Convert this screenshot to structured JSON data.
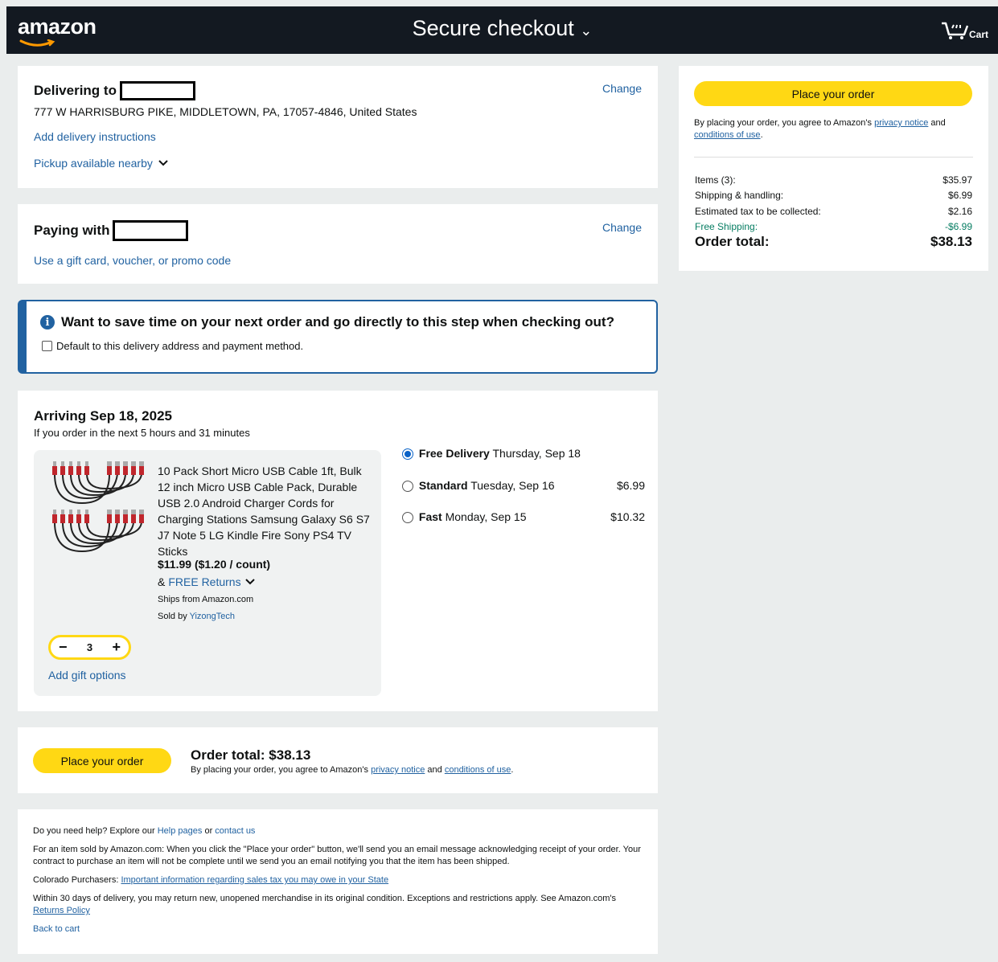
{
  "header": {
    "logo": "amazon",
    "title": "Secure checkout",
    "cart_label": "Cart"
  },
  "delivery": {
    "heading": "Delivering to",
    "address": "777 W HARRISBURG PIKE, MIDDLETOWN, PA, 17057-4846, United States",
    "change": "Change",
    "instructions_link": "Add delivery instructions",
    "pickup_link": "Pickup available nearby"
  },
  "payment": {
    "heading": "Paying with",
    "change": "Change",
    "gift_link": "Use a gift card, voucher, or promo code"
  },
  "banner": {
    "question": "Want to save time on your next order and go directly to this step when checking out?",
    "checkbox_label": "Default to this delivery address and payment method."
  },
  "shipment": {
    "arriving": "Arriving Sep 18, 2025",
    "countdown": "If you order in the next 5 hours and 31 minutes",
    "product": {
      "title": "10 Pack Short Micro USB Cable 1ft, Bulk 12 inch Micro USB Cable Pack, Durable USB 2.0 Android Charger Cords for Charging Stations Samsung Galaxy S6 S7 J7 Note 5 LG Kindle Fire Sony PS4 TV Sticks",
      "price": "$11.99 ($1.20 / count)",
      "returns_prefix": "&",
      "returns_link": "FREE Returns",
      "ships_from": "Ships from Amazon.com",
      "sold_by_prefix": "Sold by",
      "sold_by": "YizongTech",
      "quantity": "3",
      "gift_link": "Add gift options"
    },
    "options": [
      {
        "name": "Free Delivery",
        "date": "Thursday, Sep 18",
        "price": "",
        "selected": true
      },
      {
        "name": "Standard",
        "date": "Tuesday, Sep 16",
        "price": "$6.99",
        "selected": false
      },
      {
        "name": "Fast",
        "date": "Monday, Sep 15",
        "price": "$10.32",
        "selected": false
      }
    ]
  },
  "bottom_order": {
    "button": "Place your order",
    "total": "Order total: $38.13",
    "agree_prefix": "By placing your order, you agree to Amazon's",
    "privacy": "privacy notice",
    "and": "and",
    "conditions": "conditions of use",
    "period": "."
  },
  "footer": {
    "help_prefix": "Do you need help? Explore our",
    "help_pages": "Help pages",
    "or": "or",
    "contact": "contact us",
    "amazon_note": "For an item sold by Amazon.com: When you click the \"Place your order\" button, we'll send you an email message acknowledging receipt of your order. Your contract to purchase an item will not be complete until we send you an email notifying you that the item has been shipped.",
    "colorado_prefix": "Colorado Purchasers:",
    "colorado_link": "Important information regarding sales tax you may owe in your State",
    "returns_note": "Within 30 days of delivery, you may return new, unopened merchandise in its original condition. Exceptions and restrictions apply. See Amazon.com's",
    "returns_link": "Returns Policy",
    "back_to_cart": "Back to cart"
  },
  "summary": {
    "button": "Place your order",
    "agree_prefix": "By placing your order, you agree to Amazon's",
    "privacy": "privacy notice",
    "and": "and",
    "conditions": "conditions of use",
    "period": ".",
    "rows": [
      {
        "label": "Items (3):",
        "value": "$35.97"
      },
      {
        "label": "Shipping & handling:",
        "value": "$6.99"
      },
      {
        "label": "Estimated tax to be collected:",
        "value": "$2.16"
      },
      {
        "label": "Free Shipping:",
        "value": "-$6.99"
      }
    ],
    "total_label": "Order total:",
    "total_value": "$38.13"
  },
  "colors": {
    "header_bg": "#131921",
    "link": "#2162a1",
    "button_yellow": "#ffd814",
    "promo_green": "#067d62",
    "page_bg": "#eaeded"
  }
}
